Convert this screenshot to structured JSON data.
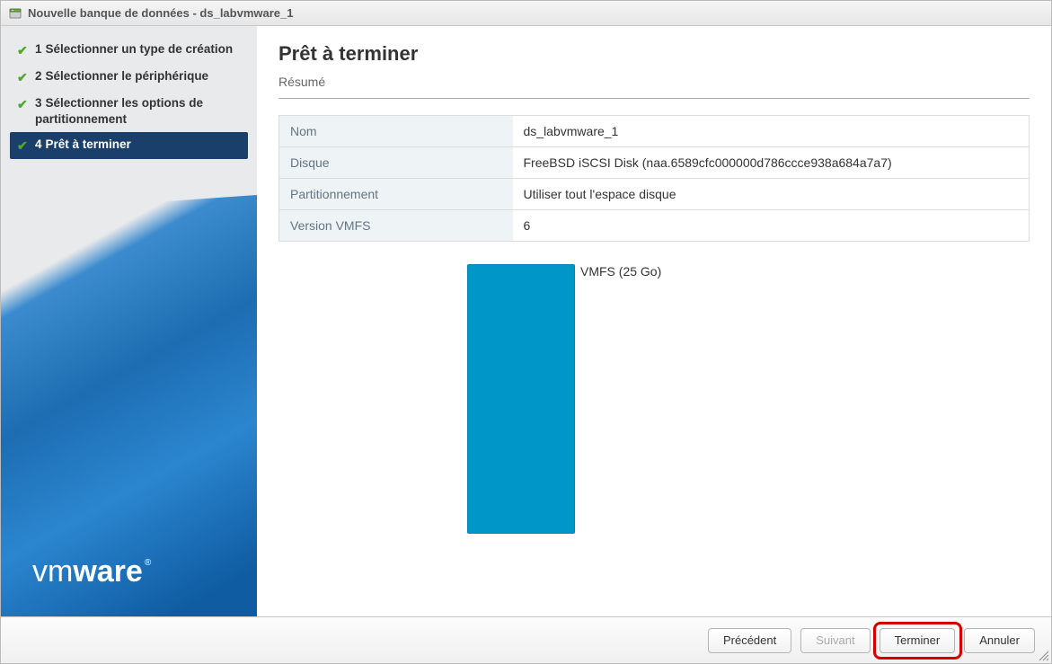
{
  "window": {
    "title": "Nouvelle banque de données - ds_labvmware_1"
  },
  "steps": [
    {
      "num": "1",
      "label": "Sélectionner un type de création",
      "done": true,
      "active": false
    },
    {
      "num": "2",
      "label": "Sélectionner le périphérique",
      "done": true,
      "active": false
    },
    {
      "num": "3",
      "label": "Sélectionner les options de partitionnement",
      "done": true,
      "active": false
    },
    {
      "num": "4",
      "label": "Prêt à terminer",
      "done": true,
      "active": true
    }
  ],
  "brand": {
    "vm": "vm",
    "ware": "ware",
    "reg": "®"
  },
  "page": {
    "heading": "Prêt à terminer",
    "subtitle": "Résumé"
  },
  "summary": [
    {
      "label": "Nom",
      "value": "ds_labvmware_1"
    },
    {
      "label": "Disque",
      "value": "FreeBSD iSCSI Disk (naa.6589cfc000000d786ccce938a684a7a7)"
    },
    {
      "label": "Partitionnement",
      "value": "Utiliser tout l'espace disque"
    },
    {
      "label": "Version VMFS",
      "value": "6"
    }
  ],
  "partition": {
    "label": "VMFS  (25 Go)"
  },
  "buttons": {
    "back": "Précédent",
    "next": "Suivant",
    "finish": "Terminer",
    "cancel": "Annuler"
  }
}
